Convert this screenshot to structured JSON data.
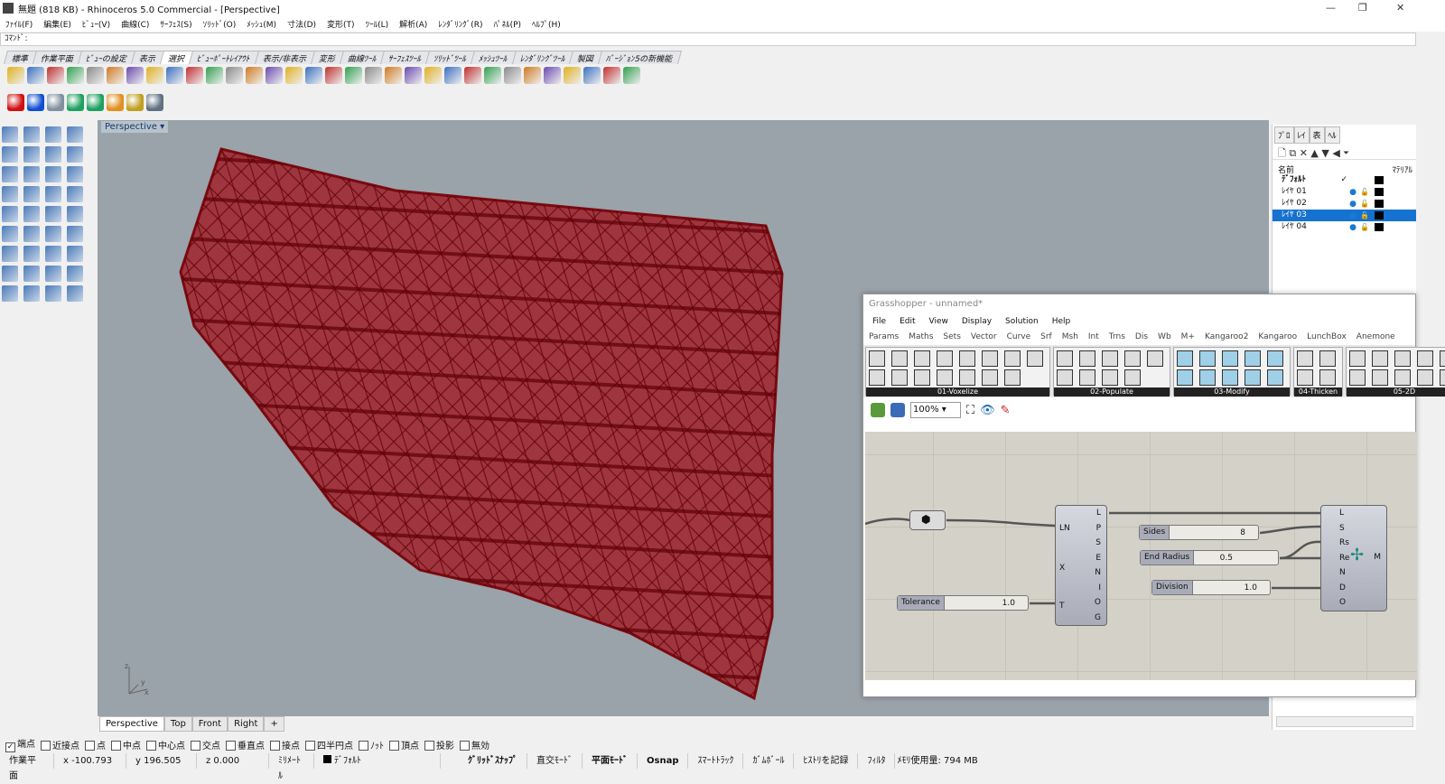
{
  "window": {
    "title": "無題 (818 KB) - Rhinoceros 5.0 Commercial - [Perspective]",
    "min": "—",
    "max": "❐",
    "close": "✕"
  },
  "menu": [
    "ﾌｧｲﾙ(F)",
    "編集(E)",
    "ﾋﾞｭｰ(V)",
    "曲線(C)",
    "ｻｰﾌｪｽ(S)",
    "ｿﾘｯﾄﾞ(O)",
    "ﾒｯｼｭ(M)",
    "寸法(D)",
    "変形(T)",
    "ﾂｰﾙ(L)",
    "解析(A)",
    "ﾚﾝﾀﾞﾘﾝｸﾞ(R)",
    "ﾊﾟﾈﾙ(P)",
    "ﾍﾙﾌﾟ(H)"
  ],
  "command": {
    "label": "ｺﾏﾝﾄﾞ:"
  },
  "toolbar_tabs": [
    "標準",
    "作業平面",
    "ﾋﾞｭｰの設定",
    "表示",
    "選択",
    "ﾋﾞｭｰﾎﾟｰﾄﾚｲｱｳﾄ",
    "表示/非表示",
    "変形",
    "曲線ﾂｰﾙ",
    "ｻｰﾌｪｽﾂｰﾙ",
    "ｿﾘｯﾄﾞﾂｰﾙ",
    "ﾒｯｼｭﾂｰﾙ",
    "ﾚﾝﾀﾞﾘﾝｸﾞﾂｰﾙ",
    "製図",
    "ﾊﾞｰｼﾞｮﾝ5の新機能"
  ],
  "active_tab": "選択",
  "viewport": {
    "label": "Perspective",
    "tabs": [
      "Perspective",
      "Top",
      "Front",
      "Right",
      "+"
    ],
    "active": "Perspective",
    "axes": {
      "z": "z",
      "y": "y",
      "x": "x"
    }
  },
  "colors": {
    "mesh": "#a0101a",
    "accent": "#1672d0",
    "viewport_bg": "#9aa2aa"
  },
  "layers_panel": {
    "tabs": [
      "ﾌﾟﾛ",
      "ﾚｲ",
      "表",
      "ﾍﾙ"
    ],
    "col_name": "名前",
    "col_material": "ﾏﾃﾘｱﾙ",
    "layers": [
      {
        "name": "ﾃﾞﾌｫﾙﾄ",
        "current": "✓"
      },
      {
        "name": "ﾚｲﾔ 01"
      },
      {
        "name": "ﾚｲﾔ 02"
      },
      {
        "name": "ﾚｲﾔ 03",
        "selected": true
      },
      {
        "name": "ﾚｲﾔ 04"
      }
    ]
  },
  "grasshopper": {
    "title": "Grasshopper - unnamed*",
    "menu": [
      "File",
      "Edit",
      "View",
      "Display",
      "Solution",
      "Help"
    ],
    "tabs": [
      "Params",
      "Maths",
      "Sets",
      "Vector",
      "Curve",
      "Srf",
      "Msh",
      "Int",
      "Trns",
      "Dis",
      "Wb",
      "M+",
      "Kangaroo2",
      "Kangaroo",
      "LunchBox",
      "Anemone"
    ],
    "panels": [
      "01-Voxelize",
      "02-Populate",
      "03-Modify",
      "04-Thicken",
      "05-2D"
    ],
    "zoom": "100%",
    "component1": {
      "inputs": [
        "LN",
        "X",
        "T"
      ],
      "outputs": [
        "L",
        "P",
        "S",
        "E",
        "N",
        "I",
        "O",
        "G"
      ]
    },
    "component2": {
      "inputs": [
        "L",
        "S",
        "Rs",
        "Re",
        "N",
        "D",
        "O"
      ],
      "output": "M"
    },
    "sliders": [
      {
        "label": "Sides",
        "value": "8"
      },
      {
        "label": "End Radius",
        "value": "0.5"
      },
      {
        "label": "Division",
        "value": "1.0"
      },
      {
        "label": "Tolerance",
        "value": "1.0"
      }
    ]
  },
  "osnap": [
    {
      "label": "端点",
      "checked": true
    },
    {
      "label": "近接点"
    },
    {
      "label": "点"
    },
    {
      "label": "中点"
    },
    {
      "label": "中心点"
    },
    {
      "label": "交点"
    },
    {
      "label": "垂直点"
    },
    {
      "label": "接点"
    },
    {
      "label": "四半円点"
    },
    {
      "label": "ﾉｯﾄ"
    },
    {
      "label": "頂点"
    },
    {
      "label": "投影"
    },
    {
      "label": "無効"
    }
  ],
  "status": {
    "cplane": "作業平面",
    "x": "x -100.793",
    "y": "y 196.505",
    "z": "z 0.000",
    "units": "ﾐﾘﾒｰﾄﾙ",
    "layer": "ﾃﾞﾌｫﾙﾄ",
    "grid_snap": "ｸﾞﾘｯﾄﾞｽﾅｯﾌﾟ",
    "ortho": "直交ﾓｰﾄﾞ",
    "planar": "平面ﾓｰﾄﾞ",
    "osnap": "Osnap",
    "smarttrack": "ｽﾏｰﾄﾄﾗｯｸ",
    "gumball": "ｶﾞﾑﾎﾞｰﾙ",
    "history": "ﾋｽﾄﾘを記録",
    "filter": "ﾌｨﾙﾀ",
    "memory": "ﾒﾓﾘ使用量: 794 MB"
  }
}
